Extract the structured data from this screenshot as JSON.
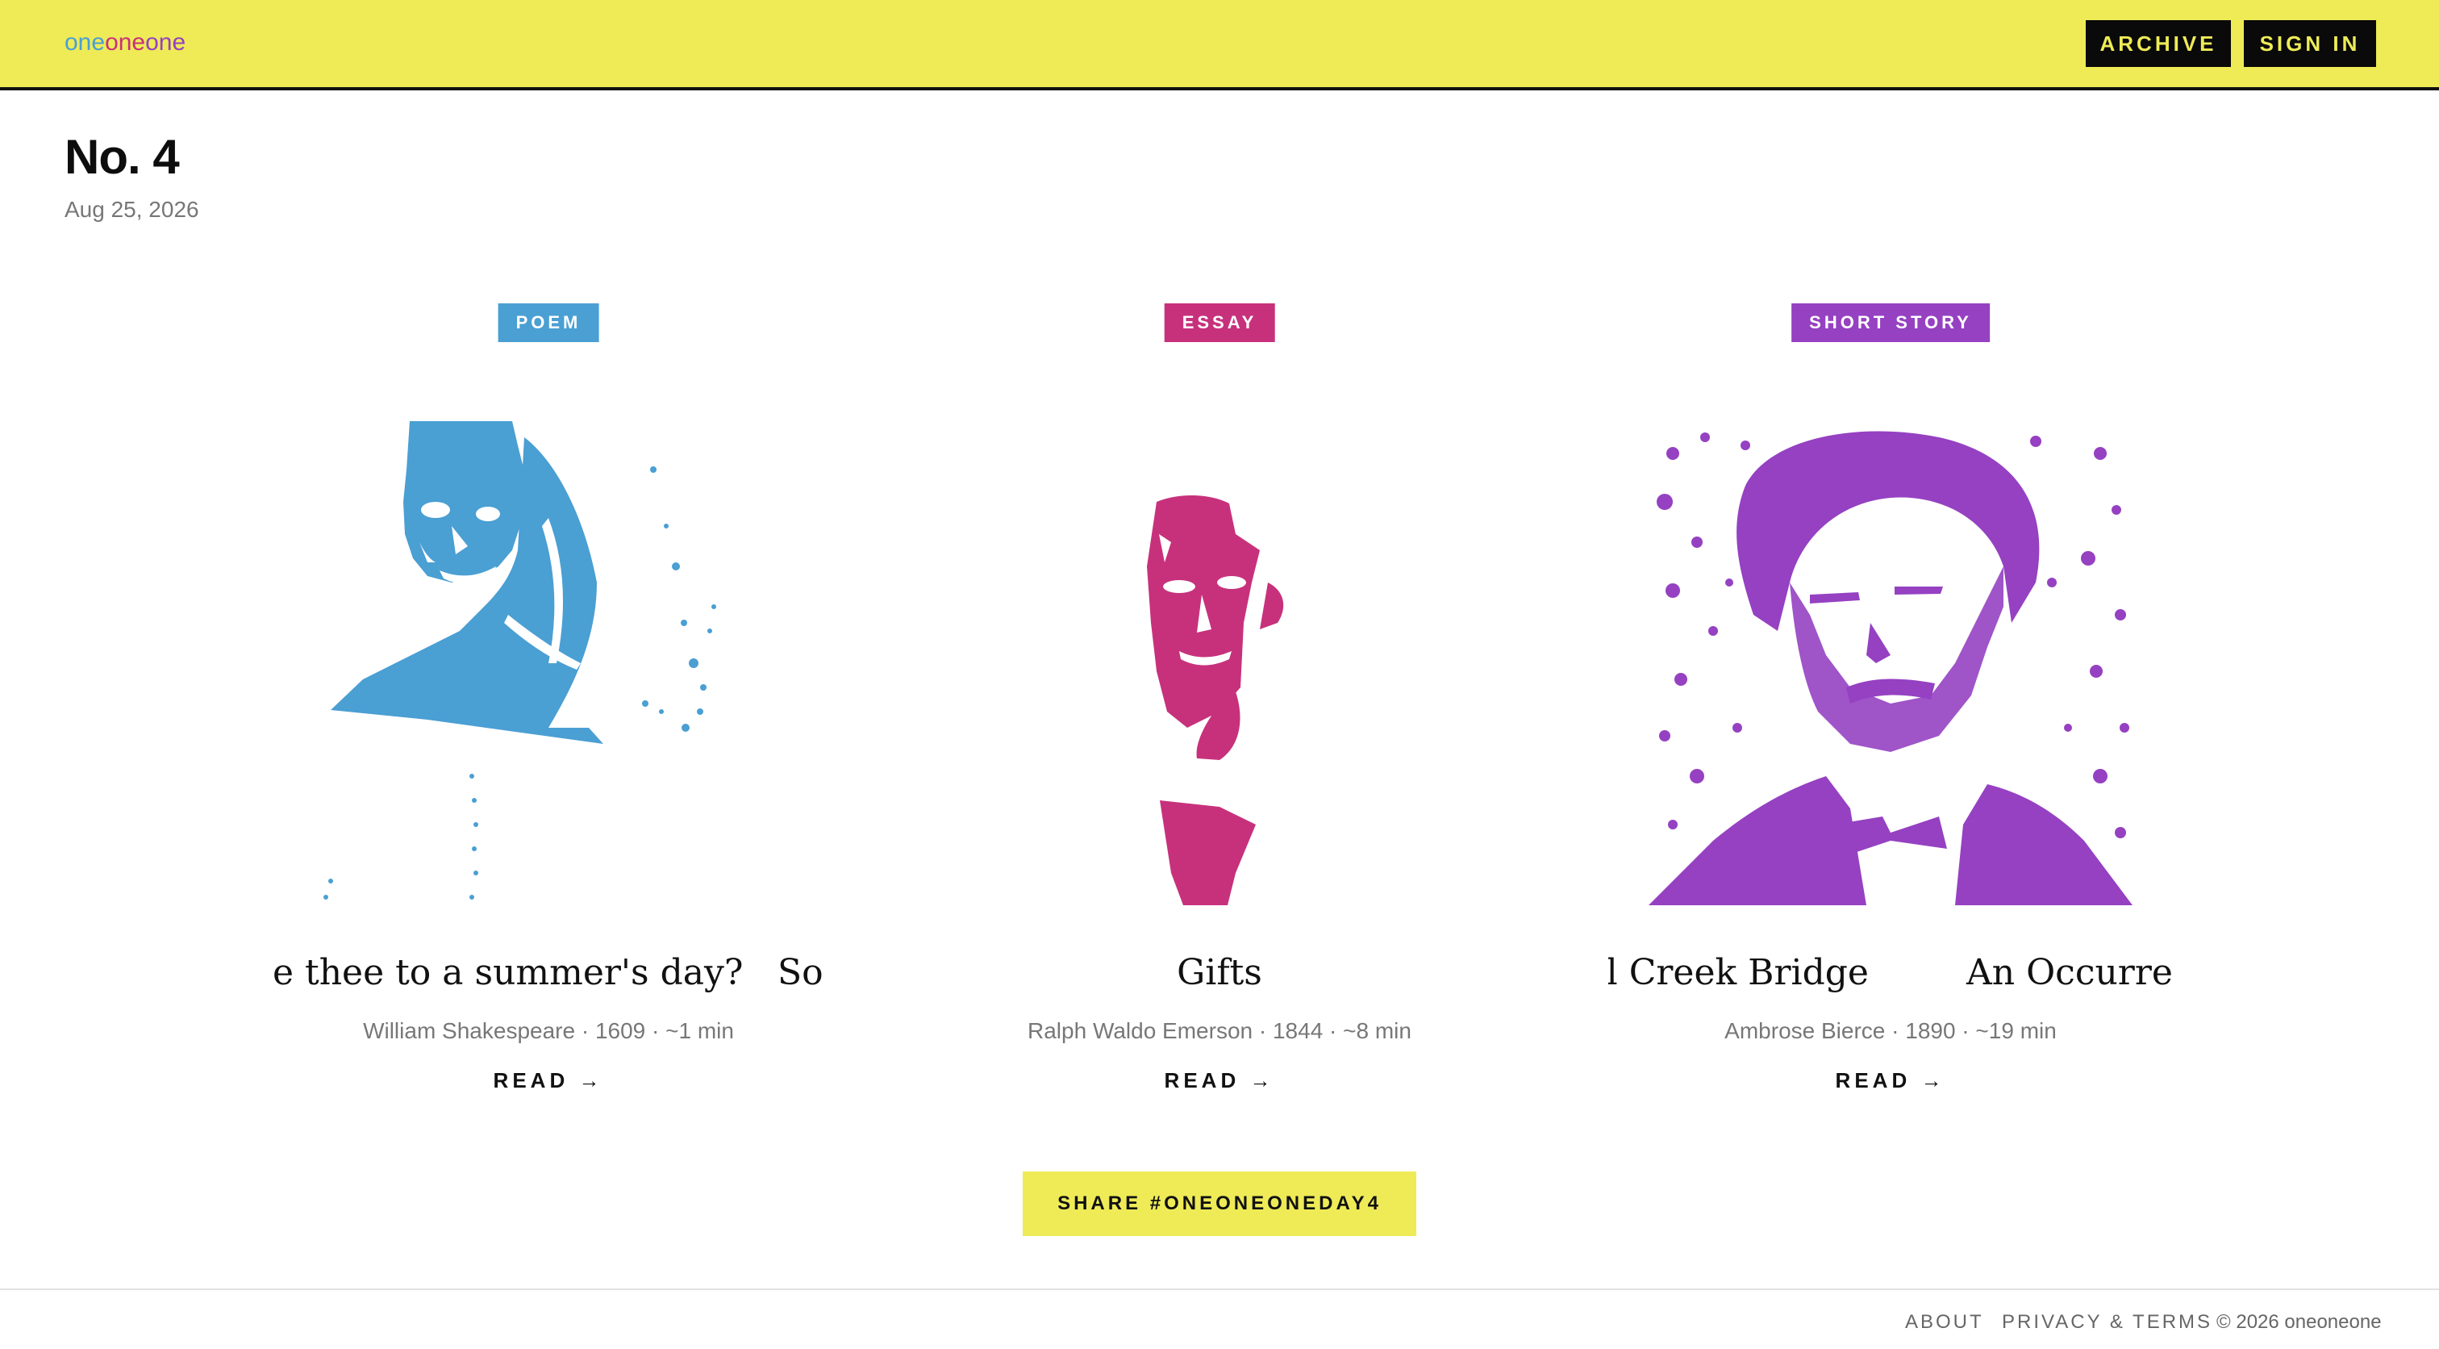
{
  "header": {
    "logo_parts": [
      "one",
      "one",
      "one"
    ],
    "logo_colors": [
      "#4a9fd3",
      "#c7317c",
      "#9541c2"
    ],
    "archive_label": "ARCHIVE",
    "signin_label": "SIGN IN",
    "bg_color": "#eeeb57"
  },
  "issue": {
    "number": "No. 4",
    "date": "Aug 25, 2026"
  },
  "works": [
    {
      "tag": "POEM",
      "color": "#4a9fd3",
      "title_visible_a": "e thee to a summer's day?",
      "title_visible_b": "So",
      "meta": "William Shakespeare · 1609 · ~1 min",
      "read_label": "READ →",
      "portrait_icon": "shakespeare-portrait"
    },
    {
      "tag": "ESSAY",
      "color": "#c7317c",
      "title": "Gifts",
      "meta": "Ralph Waldo Emerson · 1844 · ~8 min",
      "read_label": "READ →",
      "portrait_icon": "emerson-portrait"
    },
    {
      "tag": "SHORT STORY",
      "color": "#9541c2",
      "title_visible_a": "wl Creek Bridge",
      "title_visible_b": "An Occurre",
      "meta": "Ambrose Bierce · 1890 · ~19 min",
      "read_label": "READ →",
      "portrait_icon": "bierce-portrait"
    }
  ],
  "share_label": "SHARE #ONEONEONEDAY4",
  "footer": {
    "about": "ABOUT",
    "privacy": "PRIVACY & TERMS",
    "copyright": "© 2026 oneoneone"
  }
}
